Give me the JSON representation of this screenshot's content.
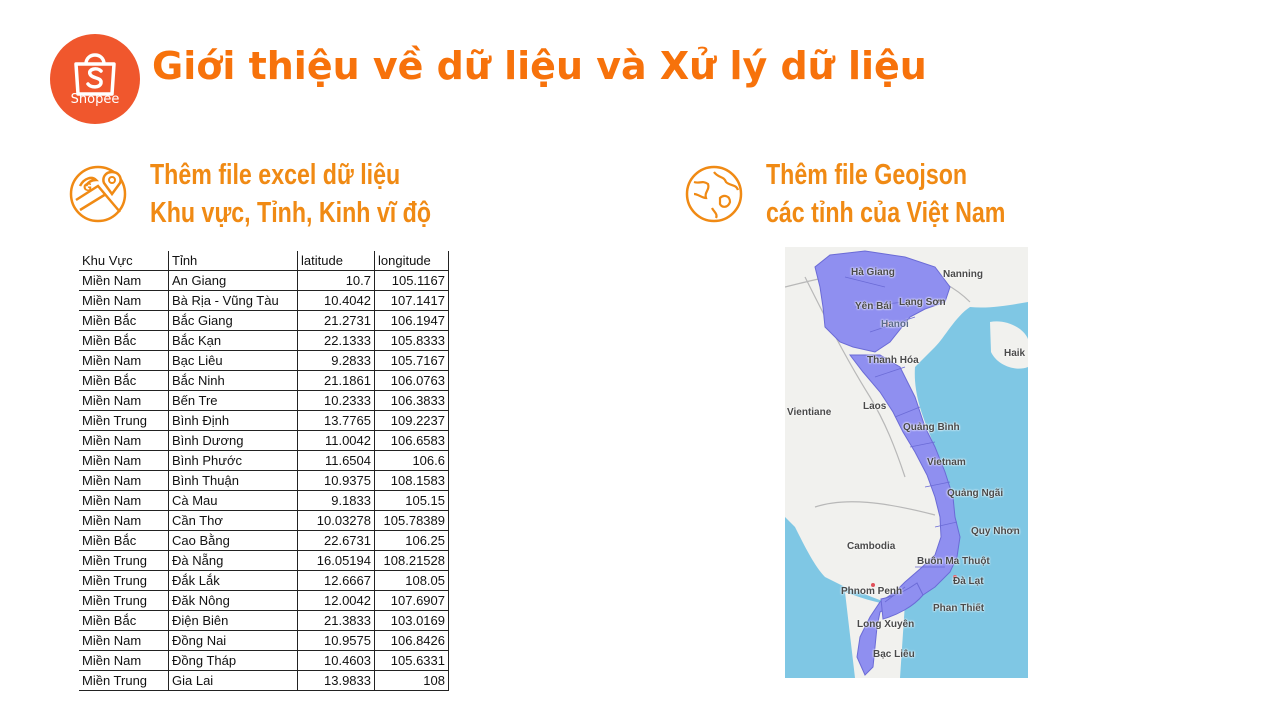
{
  "header": {
    "logo_text": "Shopee",
    "title": "Giới thiệu về dữ liệu và Xử lý dữ liệu"
  },
  "left_section": {
    "icon": "map-pin-icon",
    "heading_line1": "Thêm file excel dữ liệu",
    "heading_line2": "Khu vực, Tỉnh, Kinh vĩ độ"
  },
  "right_section": {
    "icon": "globe-icon",
    "heading_line1": "Thêm file Geojson",
    "heading_line2": "các tỉnh của Việt Nam"
  },
  "table": {
    "headers": [
      "Khu Vực",
      "Tỉnh",
      "latitude",
      "longitude"
    ],
    "rows": [
      [
        "Miền Nam",
        "An Giang",
        "10.7",
        "105.1167"
      ],
      [
        "Miền Nam",
        "Bà Rịa - Vũng Tàu",
        "10.4042",
        "107.1417"
      ],
      [
        "Miền Bắc",
        "Bắc Giang",
        "21.2731",
        "106.1947"
      ],
      [
        "Miền Bắc",
        "Bắc Kạn",
        "22.1333",
        "105.8333"
      ],
      [
        "Miền Nam",
        "Bạc Liêu",
        "9.2833",
        "105.7167"
      ],
      [
        "Miền Bắc",
        "Bắc Ninh",
        "21.1861",
        "106.0763"
      ],
      [
        "Miền Nam",
        "Bến Tre",
        "10.2333",
        "106.3833"
      ],
      [
        "Miền Trung",
        "Bình Định",
        "13.7765",
        "109.2237"
      ],
      [
        "Miền Nam",
        "Bình Dương",
        "11.0042",
        "106.6583"
      ],
      [
        "Miền Nam",
        "Bình Phước",
        "11.6504",
        "106.6"
      ],
      [
        "Miền Nam",
        "Bình Thuận",
        "10.9375",
        "108.1583"
      ],
      [
        "Miền Nam",
        "Cà Mau",
        "9.1833",
        "105.15"
      ],
      [
        "Miền Nam",
        "Cần Thơ",
        "10.03278",
        "105.78389"
      ],
      [
        "Miền Bắc",
        "Cao Bằng",
        "22.6731",
        "106.25"
      ],
      [
        "Miền Trung",
        "Đà Nẵng",
        "16.05194",
        "108.21528"
      ],
      [
        "Miền Trung",
        "Đắk Lắk",
        "12.6667",
        "108.05"
      ],
      [
        "Miền Trung",
        "Đăk Nông",
        "12.0042",
        "107.6907"
      ],
      [
        "Miền Bắc",
        "Điện Biên",
        "21.3833",
        "103.0169"
      ],
      [
        "Miền Nam",
        "Đồng Nai",
        "10.9575",
        "106.8426"
      ],
      [
        "Miền Nam",
        "Đồng Tháp",
        "10.4603",
        "105.6331"
      ],
      [
        "Miền Trung",
        "Gia Lai",
        "13.9833",
        "108"
      ]
    ]
  },
  "map": {
    "labels": {
      "ha_giang": "Hà Giang",
      "nanning": "Nanning",
      "yen_bai": "Yên Bái",
      "lang_son": "Lạng Sơn",
      "hanoi": "Hanoi",
      "thanh_hoa": "Thanh Hóa",
      "haik": "Haik",
      "vientiane": "Vientiane",
      "laos": "Laos",
      "quang_binh": "Quảng Bình",
      "vietnam": "Vietnam",
      "quang_ngai": "Quảng Ngãi",
      "quy_nhon": "Quy Nhơn",
      "cambodia": "Cambodia",
      "buon_ma_thuot": "Buôn Ma Thuột",
      "da_lat": "Đà Lạt",
      "phnom_penh": "Phnom Penh",
      "phan_thiet": "Phan Thiết",
      "long_xuyen": "Long Xuyên",
      "bac_lieu": "Bạc Liêu"
    }
  },
  "colors": {
    "brand": "#f0572d",
    "title": "#f7720b",
    "heading": "#f08a14",
    "sea": "#7fc7e4",
    "land": "#f1f1ee",
    "vietnam_fill": "#8f8ff0"
  }
}
